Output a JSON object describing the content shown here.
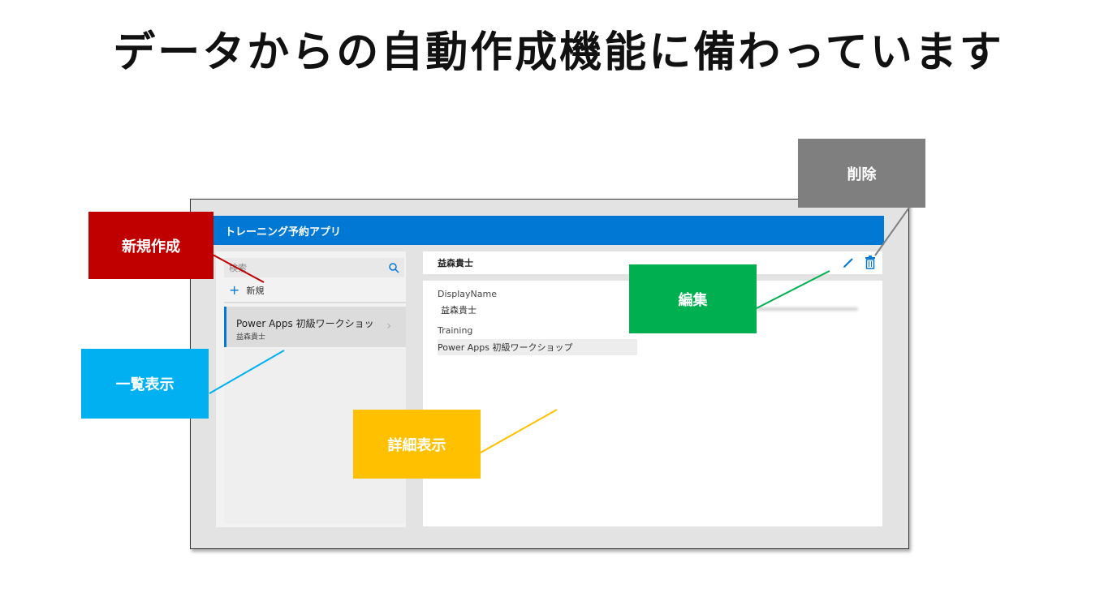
{
  "title": "データからの自動作成機能に備わっています",
  "app": {
    "header_title": "トレーニング予約アプリ",
    "search_placeholder": "検索",
    "new_label": "新規",
    "list": [
      {
        "title": "Power Apps 初級ワークショッ",
        "subtitle": "益森貴士"
      }
    ],
    "detail": {
      "header_title": "益森貴士",
      "fields": [
        {
          "label": "DisplayName",
          "value": "益森貴士"
        },
        {
          "label": "Training",
          "value": "Power Apps 初級ワークショップ"
        }
      ]
    }
  },
  "callouts": {
    "delete": {
      "label": "削除",
      "color": "#7f7f7f",
      "line_color": "#7f7f7f"
    },
    "new": {
      "label": "新規作成",
      "color": "#c00000",
      "line_color": "#c00000"
    },
    "edit": {
      "label": "編集",
      "color": "#00b050",
      "line_color": "#00b050"
    },
    "list_view": {
      "label": "一覧表示",
      "color": "#00b0f0",
      "line_color": "#00b0f0"
    },
    "detail_view": {
      "label": "詳細表示",
      "color": "#ffc000",
      "line_color": "#ffc000"
    }
  },
  "colors": {
    "accent": "#0078d4"
  },
  "icons": [
    "search-icon",
    "plus-icon",
    "chevron-right-icon",
    "pencil-icon",
    "trash-icon"
  ]
}
